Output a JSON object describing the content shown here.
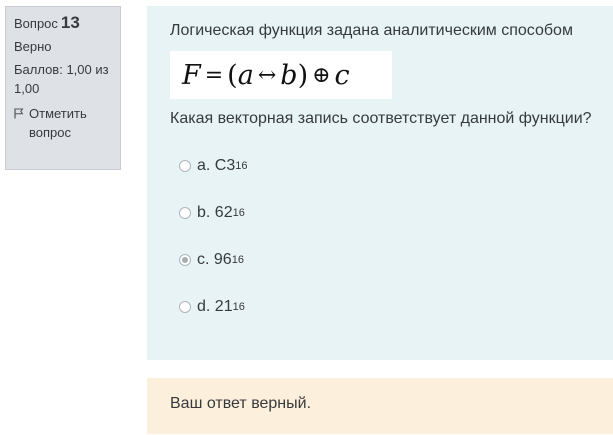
{
  "info": {
    "question_label": "Вопрос",
    "question_number": "13",
    "status": "Верно",
    "score": "Баллов: 1,00 из 1,00",
    "flag_label": "Отметить вопрос"
  },
  "question": {
    "text": "Логическая функция задана аналитическим способом",
    "formula": {
      "lhs": "F",
      "eq": "=",
      "open": "(",
      "a": "a",
      "iff": "↔",
      "b": "b",
      "close": ")",
      "xor": "⊕",
      "c": "c"
    },
    "prompt": "Какая векторная запись соответствует данной функции?"
  },
  "answers": [
    {
      "letter": "a.",
      "value": "C3",
      "base": "16",
      "selected": false
    },
    {
      "letter": "b.",
      "value": "62",
      "base": "16",
      "selected": false
    },
    {
      "letter": "c.",
      "value": "96",
      "base": "16",
      "selected": true
    },
    {
      "letter": "d.",
      "value": "21",
      "base": "16",
      "selected": false
    }
  ],
  "feedback": "Ваш ответ верный.",
  "colors": {
    "info_bg": "#dee2e6",
    "content_bg": "#e7f3f5",
    "feedback_bg": "#fcefdc",
    "text": "#373a3c"
  }
}
